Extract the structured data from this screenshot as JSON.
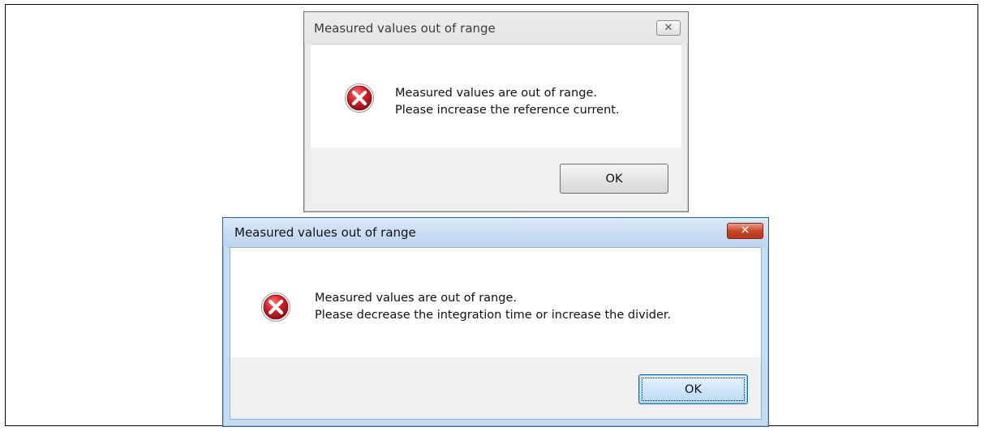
{
  "dialog1": {
    "title": "Measured values out of range",
    "close_glyph": "✕",
    "icon": "error-icon",
    "message_line1": "Measured values are out of range.",
    "message_line2": "Please increase the reference current.",
    "ok_label": "OK",
    "state": "inactive"
  },
  "dialog2": {
    "title": "Measured values out of range",
    "close_glyph": "✕",
    "icon": "error-icon",
    "message_line1": "Measured values are out of range.",
    "message_line2": "Please decrease the integration time or increase the divider.",
    "ok_label": "OK",
    "state": "active"
  },
  "colors": {
    "error_red": "#d3232b",
    "active_frame": "#c6dcf3",
    "inactive_frame": "#ececec"
  }
}
